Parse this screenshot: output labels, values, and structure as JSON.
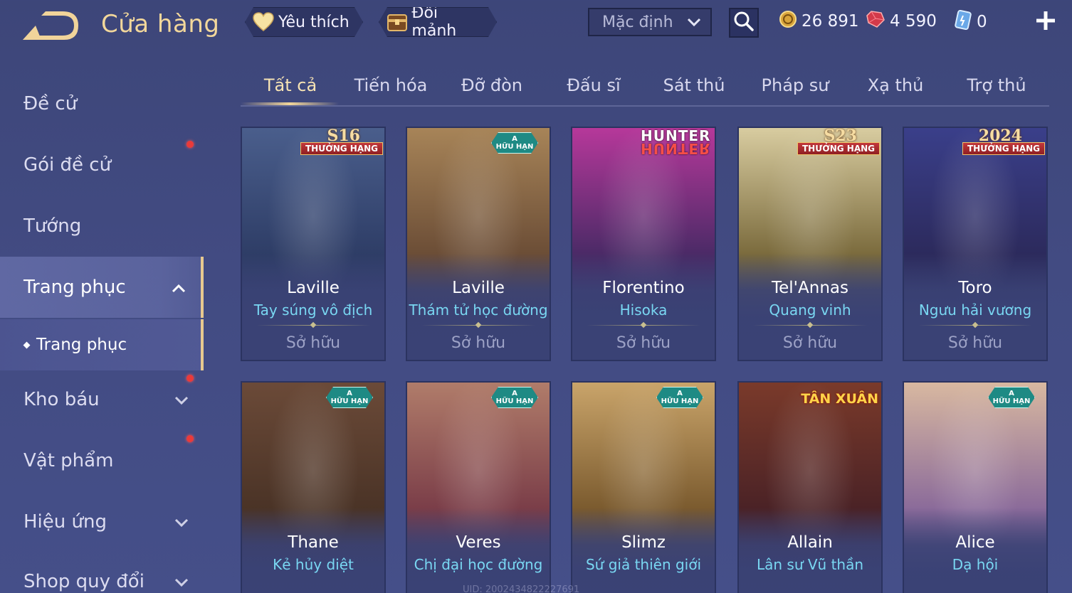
{
  "header": {
    "title": "Cửa hàng",
    "favorite_label": "Yêu thích",
    "exchange_label": "Đổi mảnh",
    "sort_value": "Mặc định",
    "currencies": {
      "gold": "26 891",
      "ruby": "4 590",
      "voucher": "0"
    }
  },
  "sidebar": {
    "items": [
      {
        "label": "Đề cử"
      },
      {
        "label": "Gói đề cử"
      },
      {
        "label": "Tướng"
      },
      {
        "label": "Trang phục"
      },
      {
        "label": "Trang phục"
      },
      {
        "label": "Kho báu"
      },
      {
        "label": "Vật phẩm"
      },
      {
        "label": "Hiệu ứng"
      },
      {
        "label": "Shop quy đổi"
      }
    ]
  },
  "tabs": [
    {
      "label": "Tất cả"
    },
    {
      "label": "Tiến hóa"
    },
    {
      "label": "Đỡ đòn"
    },
    {
      "label": "Đấu sĩ"
    },
    {
      "label": "Sát thủ"
    },
    {
      "label": "Pháp sư"
    },
    {
      "label": "Xạ thủ"
    },
    {
      "label": "Trợ thủ"
    }
  ],
  "cards": [
    {
      "hero": "Laville",
      "skin": "Tay súng vô địch",
      "status": "Sở hữu",
      "badge_text": "THƯỞNG HẠNG",
      "badge_season": "S16",
      "art_top": "#4a5e8c",
      "art_mid": "#2e3d66"
    },
    {
      "hero": "Laville",
      "skin": "Thám tử học đường",
      "status": "Sở hữu",
      "badge_limited_top": "A",
      "badge_limited_bottom": "HỮU HẠN",
      "art_top": "#a78458",
      "art_mid": "#6b4d36"
    },
    {
      "hero": "Florentino",
      "skin": "Hisoka",
      "status": "Sở hữu",
      "badge_hunter": "HUNTER",
      "art_top": "#b6389a",
      "art_mid": "#4a2a66"
    },
    {
      "hero": "Tel'Annas",
      "skin": "Quang vinh",
      "status": "Sở hữu",
      "badge_text": "THƯỞNG HẠNG",
      "badge_season": "S23",
      "art_top": "#d8cca0",
      "art_mid": "#7a6a3c"
    },
    {
      "hero": "Toro",
      "skin": "Ngưu hải vương",
      "status": "Sở hữu",
      "badge_text": "THƯỞNG HẠNG",
      "badge_season": "2024",
      "art_top": "#3a3f8a",
      "art_mid": "#2c2a5c"
    },
    {
      "hero": "Thane",
      "skin": "Kẻ hủy diệt",
      "status": "",
      "badge_limited_top": "A",
      "badge_limited_bottom": "HỮU HẠN",
      "art_top": "#6b4a38",
      "art_mid": "#4a3326"
    },
    {
      "hero": "Veres",
      "skin": "Chị đại học đường",
      "status": "",
      "badge_limited_top": "A",
      "badge_limited_bottom": "HỮU HẠN",
      "art_top": "#b07c6a",
      "art_mid": "#7a3d48"
    },
    {
      "hero": "Slimz",
      "skin": "Sứ giả thiên giới",
      "status": "",
      "badge_limited_top": "A",
      "badge_limited_bottom": "HỮU HẠN",
      "art_top": "#c9a46a",
      "art_mid": "#7a5a2e"
    },
    {
      "hero": "Allain",
      "skin": "Lân sư Vũ thần",
      "status": "",
      "badge_event": "TÂN XUÂN",
      "art_top": "#7a3a2a",
      "art_mid": "#4a2226"
    },
    {
      "hero": "Alice",
      "skin": "Dạ hội",
      "status": "",
      "badge_limited_top": "A",
      "badge_limited_bottom": "HỮU HẠN",
      "art_top": "#d8b8a0",
      "art_mid": "#8a6a9a"
    }
  ],
  "footer": {
    "uid_text": "UID: 2002434822227691"
  },
  "colors": {
    "accent_gold": "#f2d79b",
    "skin_name": "#79d7f2",
    "badge_red": "#c2373b",
    "limited_teal": "#1e8a84"
  }
}
